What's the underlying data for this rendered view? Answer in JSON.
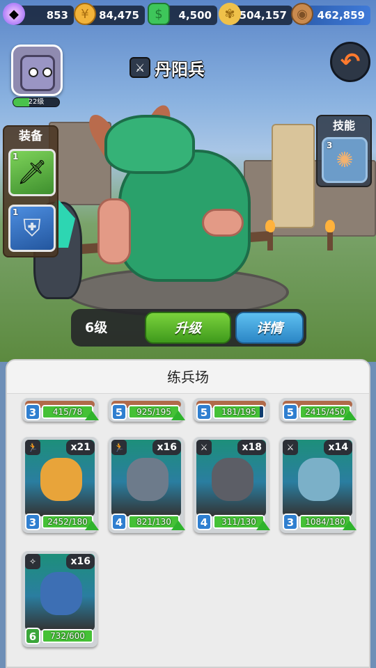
{
  "resources": [
    {
      "name": "gem",
      "value": "853",
      "icon": "gem-icon",
      "color": "#c785ff"
    },
    {
      "name": "coin",
      "value": "84,475",
      "icon": "coin-icon",
      "color": "#f2b33a"
    },
    {
      "name": "ticket",
      "value": "4,500",
      "icon": "ticket-icon",
      "color": "#3ec65a"
    },
    {
      "name": "wheat",
      "value": "504,157",
      "icon": "wheat-icon",
      "color": "#f0c14a"
    },
    {
      "name": "wood",
      "value": "462,859",
      "icon": "wood-icon",
      "color": "#c98a4e"
    }
  ],
  "player": {
    "level": "22级",
    "level_progress": 0.35
  },
  "unit": {
    "name": "丹阳兵",
    "type_icon": "sword-icon",
    "level": "6级"
  },
  "equipment": {
    "header": "装备",
    "slots": [
      {
        "count": "1",
        "icon": "sword-icon"
      },
      {
        "count": "1",
        "icon": "armor-icon"
      }
    ]
  },
  "skill": {
    "header": "技能",
    "count": "3",
    "icon": "scroll-icon"
  },
  "buttons": {
    "upgrade": "升级",
    "detail": "详情"
  },
  "barracks": {
    "title": "练兵场",
    "top_row": [
      {
        "level": "3",
        "progress": "415/78",
        "upgradeable": true
      },
      {
        "level": "5",
        "progress": "925/195",
        "upgradeable": true
      },
      {
        "level": "5",
        "progress": "181/195",
        "upgradeable": false
      },
      {
        "level": "5",
        "progress": "2415/450",
        "upgradeable": true
      }
    ],
    "cards": [
      {
        "type": "run-icon",
        "qty": "x21",
        "level": "3",
        "progress": "2452/180",
        "upgradeable": true,
        "color": "#e8a43a"
      },
      {
        "type": "run-icon",
        "qty": "x16",
        "level": "4",
        "progress": "821/130",
        "upgradeable": true,
        "color": "#6d7b8b"
      },
      {
        "type": "sword-icon",
        "qty": "x18",
        "level": "4",
        "progress": "311/130",
        "upgradeable": true,
        "color": "#5c5e66"
      },
      {
        "type": "sword-icon",
        "qty": "x14",
        "level": "3",
        "progress": "1084/180",
        "upgradeable": true,
        "color": "#7bb0c8"
      },
      {
        "type": "magic-icon",
        "qty": "x16",
        "level": "6",
        "progress": "732/600",
        "upgradeable": false,
        "color": "#3d6fb4"
      }
    ]
  }
}
